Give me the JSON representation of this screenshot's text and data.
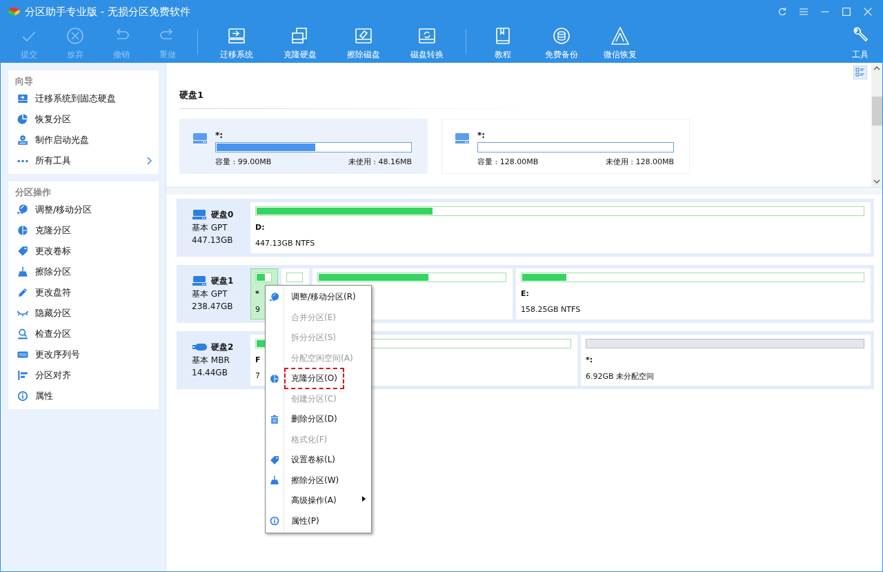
{
  "window": {
    "title": "分区助手专业版 - 无损分区免费软件"
  },
  "toolbar": [
    {
      "label": "提交",
      "disabled": true
    },
    {
      "label": "放弃",
      "disabled": true
    },
    {
      "label": "撤销",
      "disabled": true
    },
    {
      "label": "重做",
      "disabled": true
    },
    {
      "label": "迁移系统",
      "disabled": false
    },
    {
      "label": "克隆硬盘",
      "disabled": false
    },
    {
      "label": "擦除磁盘",
      "disabled": false
    },
    {
      "label": "磁盘转换",
      "disabled": false
    },
    {
      "label": "教程",
      "disabled": false
    },
    {
      "label": "免费备份",
      "disabled": false
    },
    {
      "label": "微信恢复",
      "disabled": false
    },
    {
      "label": "工具",
      "disabled": false
    }
  ],
  "sidebar": [
    {
      "title": "向导",
      "items": [
        {
          "label": "迁移系统到固态硬盘",
          "has_submenu": false
        },
        {
          "label": "恢复分区",
          "has_submenu": false
        },
        {
          "label": "制作启动光盘",
          "has_submenu": false
        },
        {
          "label": "所有工具",
          "has_submenu": true
        }
      ]
    },
    {
      "title": "分区操作",
      "items": [
        {
          "label": "调整/移动分区",
          "has_submenu": false
        },
        {
          "label": "克隆分区",
          "has_submenu": false
        },
        {
          "label": "更改卷标",
          "has_submenu": false
        },
        {
          "label": "擦除分区",
          "has_submenu": false
        },
        {
          "label": "更改盘符",
          "has_submenu": false
        },
        {
          "label": "隐藏分区",
          "has_submenu": false
        },
        {
          "label": "检查分区",
          "has_submenu": false
        },
        {
          "label": "更改序列号",
          "has_submenu": false
        },
        {
          "label": "分区对齐",
          "has_submenu": false
        },
        {
          "label": "属性",
          "has_submenu": false
        }
      ]
    }
  ],
  "detail_panel": {
    "title": "硬盘1",
    "cards": [
      {
        "label": "*:",
        "level": 0.51,
        "capacity": "容量 : 99.00MB",
        "unused": "未使用 : 48.16MB",
        "selected": true
      },
      {
        "label": "*:",
        "level": 0,
        "capacity": "容量 : 128.00MB",
        "unused": "未使用 : 128.00MB",
        "selected": false
      }
    ]
  },
  "disks": [
    {
      "name": "硬盘0",
      "style": "基本 GPT",
      "size": "447.13GB",
      "kind": "hdd",
      "partitions": [
        {
          "kind": "used",
          "label": "D:",
          "info": "447.13GB NTFS",
          "level": 0.29,
          "selected": false
        }
      ]
    },
    {
      "name": "硬盘1",
      "style": "基本 GPT",
      "size": "238.47GB",
      "kind": "hdd",
      "partitions": [
        {
          "kind": "used",
          "label": "*",
          "info": "9",
          "level": 0.62,
          "selected": true
        },
        {
          "kind": "used",
          "level": 0,
          "selected": false
        },
        {
          "kind": "used",
          "level": 0.59,
          "selected": false
        },
        {
          "kind": "used",
          "label": "E:",
          "info": "158.25GB NTFS",
          "level": 0.13,
          "selected": false
        }
      ]
    },
    {
      "name": "硬盘2",
      "style": "基本 MBR",
      "size": "14.44GB",
      "kind": "usb",
      "partitions": [
        {
          "kind": "used",
          "label": "F",
          "info": "7",
          "level": 0.2,
          "selected": false
        },
        {
          "kind": "unallocated",
          "label": "*:",
          "info": "6.92GB 未分配空间",
          "selected": false
        }
      ]
    }
  ],
  "context_menu": [
    {
      "label": "调整/移动分区(R)",
      "disabled": false,
      "highlighted": false,
      "has_submenu": false
    },
    {
      "label": "合并分区(E)",
      "disabled": true,
      "highlighted": false,
      "has_submenu": false
    },
    {
      "label": "拆分分区(S)",
      "disabled": true,
      "highlighted": false,
      "has_submenu": false
    },
    {
      "label": "分配空闲空间(A)",
      "disabled": true,
      "highlighted": false,
      "has_submenu": false
    },
    {
      "label": "克隆分区(O)",
      "disabled": false,
      "highlighted": true,
      "has_submenu": false
    },
    {
      "label": "创建分区(C)",
      "disabled": true,
      "highlighted": false,
      "has_submenu": false
    },
    {
      "label": "删除分区(D)",
      "disabled": false,
      "highlighted": false,
      "has_submenu": false
    },
    {
      "label": "格式化(F)",
      "disabled": true,
      "highlighted": false,
      "has_submenu": false
    },
    {
      "label": "设置卷标(L)",
      "disabled": false,
      "highlighted": false,
      "has_submenu": false
    },
    {
      "label": "擦除分区(W)",
      "disabled": false,
      "highlighted": false,
      "has_submenu": false
    },
    {
      "label": "高级操作(A)",
      "disabled": false,
      "highlighted": false,
      "has_submenu": true
    },
    {
      "label": "属性(P)",
      "disabled": false,
      "highlighted": false,
      "has_submenu": false
    }
  ]
}
